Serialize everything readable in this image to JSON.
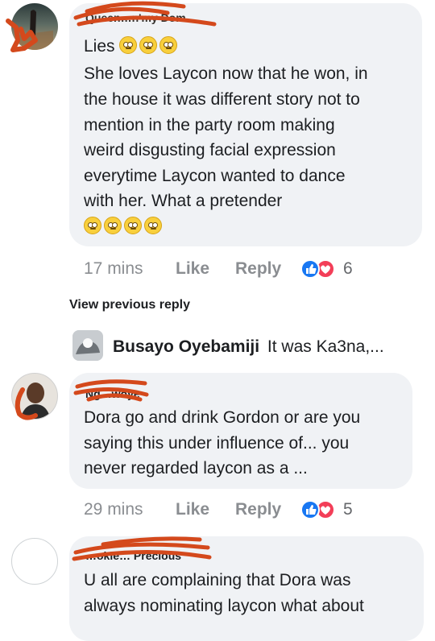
{
  "comments": [
    {
      "author": "Queen…n'my Dom",
      "text_lines": [
        "Lies",
        "She loves Laycon now that he won, in",
        "the house it was different story not to",
        "mention in the party room making",
        "weird disgusting facial expression",
        "everytime Laycon wanted to dance",
        "with her. What a pretender"
      ],
      "time": "17 mins",
      "like_label": "Like",
      "reply_label": "Reply",
      "reaction_count": "6"
    },
    {
      "author": "Ng…woye",
      "text_lines": [
        "Dora go and drink Gordon or are you",
        "saying this under influence of... you",
        "never regarded laycon as a ..."
      ],
      "time": "29 mins",
      "like_label": "Like",
      "reply_label": "Reply",
      "reaction_count": "5"
    },
    {
      "author": "…okie… Precious",
      "text_lines": [
        "U all are complaining that Dora was",
        "always nominating laycon what about"
      ]
    }
  ],
  "view_previous_reply": "View previous reply",
  "reply_preview": {
    "author": "Busayo Oyebamiji",
    "text": "It was Ka3na,..."
  },
  "colors": {
    "bubble": "#f0f2f5",
    "meta_text": "#8a8d91",
    "like_blue": "#1877f2",
    "love_red": "#f33e58",
    "redaction": "#d4491c"
  }
}
